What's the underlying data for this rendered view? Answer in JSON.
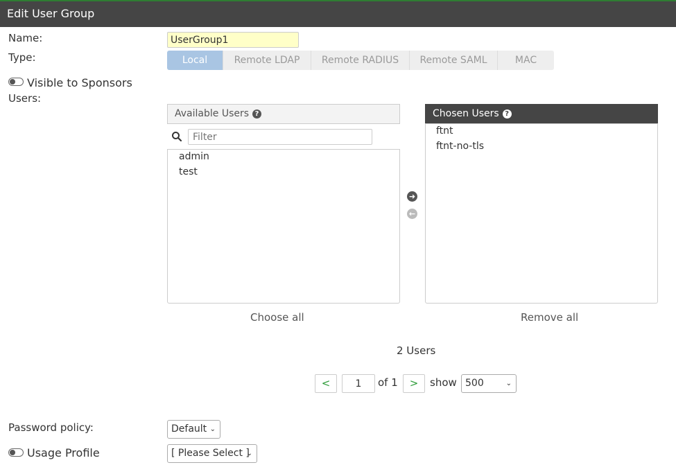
{
  "header": {
    "title": "Edit User Group"
  },
  "form": {
    "name_label": "Name:",
    "name_value": "UserGroup1",
    "type_label": "Type:",
    "type_options": [
      "Local",
      "Remote LDAP",
      "Remote RADIUS",
      "Remote SAML",
      "MAC"
    ],
    "type_selected": "Local",
    "visible_sponsors_label": "Visible to Sponsors",
    "users_label": "Users:"
  },
  "available": {
    "title": "Available Users",
    "filter_placeholder": "Filter",
    "items": [
      "admin",
      "test"
    ],
    "choose_all": "Choose all"
  },
  "chosen": {
    "title": "Chosen Users",
    "items": [
      "ftnt",
      "ftnt-no-tls"
    ],
    "remove_all": "Remove all"
  },
  "pagination": {
    "count_text": "2 Users",
    "prev": "<",
    "page": "1",
    "of_text": "of 1",
    "next": ">",
    "show_text": "show",
    "page_size": "500"
  },
  "password_policy": {
    "label": "Password policy:",
    "value": "Default"
  },
  "usage_profile": {
    "label": "Usage Profile",
    "value": "[ Please Select ]"
  },
  "colors": {
    "title_bar": "#454545",
    "accent_green": "#2e9c3a",
    "segment_active": "#a9c5e3",
    "name_field": "#ffffc8"
  }
}
